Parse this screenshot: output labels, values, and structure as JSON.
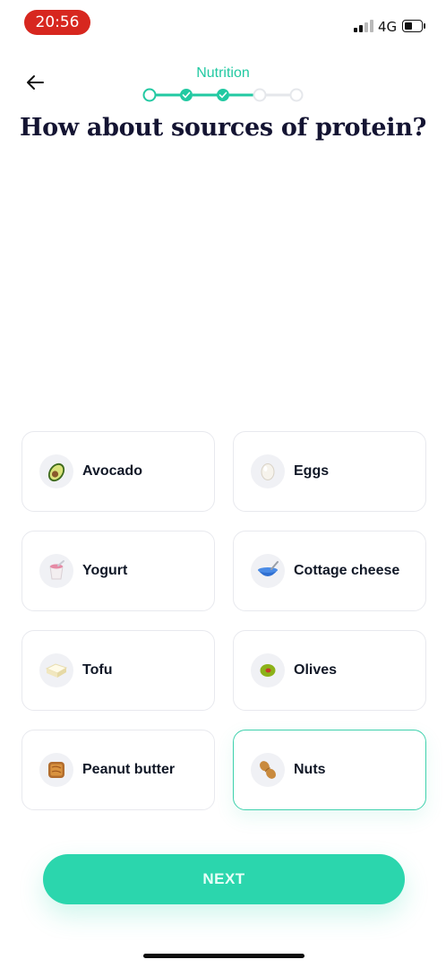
{
  "status_bar": {
    "time": "20:56",
    "network": "4G",
    "battery_level": 0.3
  },
  "header": {
    "step_title": "Nutrition",
    "progress": {
      "total_steps": 5,
      "completed_steps": 2,
      "current_step": 3
    },
    "heading": "How about sources of protein?"
  },
  "options": [
    {
      "label": "Avocado",
      "icon": "avocado-icon",
      "selected": false
    },
    {
      "label": "Eggs",
      "icon": "egg-icon",
      "selected": false
    },
    {
      "label": "Yogurt",
      "icon": "yogurt-icon",
      "selected": false
    },
    {
      "label": "Cottage cheese",
      "icon": "bowl-icon",
      "selected": false
    },
    {
      "label": "Tofu",
      "icon": "tofu-icon",
      "selected": false
    },
    {
      "label": "Olives",
      "icon": "olive-icon",
      "selected": false
    },
    {
      "label": "Peanut butter",
      "icon": "peanut-butter-icon",
      "selected": false
    },
    {
      "label": "Nuts",
      "icon": "peanut-icon",
      "selected": true
    }
  ],
  "next_button": {
    "label": "NEXT"
  },
  "colors": {
    "accent": "#22c9a2",
    "button": "#2bd6ad",
    "time_pill": "#d7271f",
    "heading": "#141432"
  }
}
